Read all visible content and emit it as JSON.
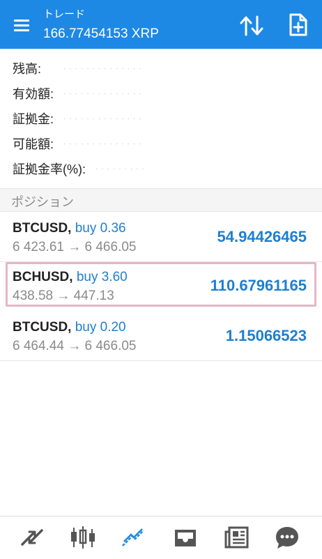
{
  "header": {
    "title": "トレード",
    "subtitle": "166.77454153 XRP"
  },
  "account": {
    "rows": [
      {
        "label": "残高:"
      },
      {
        "label": "有効額:"
      },
      {
        "label": "証拠金:"
      },
      {
        "label": "可能額:"
      },
      {
        "label": "証拠金率(%):"
      }
    ]
  },
  "positions": {
    "section_title": "ポジション",
    "items": [
      {
        "symbol": "BTCUSD,",
        "side": "buy 0.36",
        "prices": "6 423.61 → 6 466.05",
        "profit": "54.94426465"
      },
      {
        "symbol": "BCHUSD,",
        "side": "buy 3.60",
        "prices": "438.58 → 447.13",
        "profit": "110.67961165"
      },
      {
        "symbol": "BTCUSD,",
        "side": "buy 0.20",
        "prices": "6 464.44 → 6 466.05",
        "profit": "1.15066523"
      }
    ]
  },
  "bottom_nav": {
    "items": [
      "quotes-icon",
      "chart-icon",
      "trade-icon",
      "history-icon",
      "news-icon",
      "chat-icon"
    ]
  },
  "colors": {
    "header_bg": "#1e88e5",
    "profit_blue": "#1e7fd0",
    "selected_border": "#e7b5c6",
    "icon_gray": "#555555"
  }
}
